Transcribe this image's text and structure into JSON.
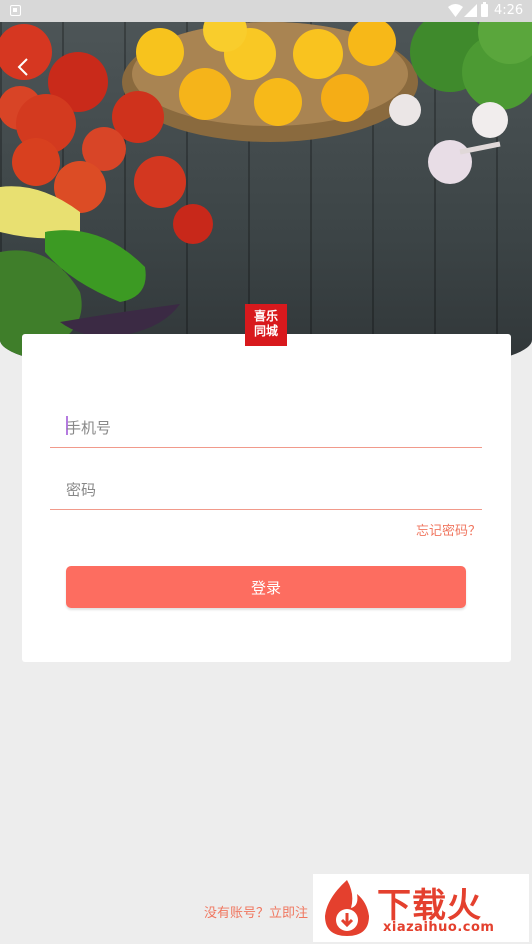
{
  "status_bar": {
    "time": "4:26"
  },
  "header": {
    "back_icon": "chevron-left-icon"
  },
  "logo": {
    "line1": "喜乐",
    "line2": "同城"
  },
  "form": {
    "phone_placeholder": "手机号",
    "password_placeholder": "密码",
    "forgot_label": "忘记密码？",
    "login_label": "登录"
  },
  "footer": {
    "register_label": "没有账号？立即注"
  },
  "watermark": {
    "title": "下载火",
    "subtitle": "xiazaihuo.com"
  },
  "colors": {
    "accent": "#fd6d60",
    "link": "#f07760",
    "logo_red": "#d8191d"
  }
}
